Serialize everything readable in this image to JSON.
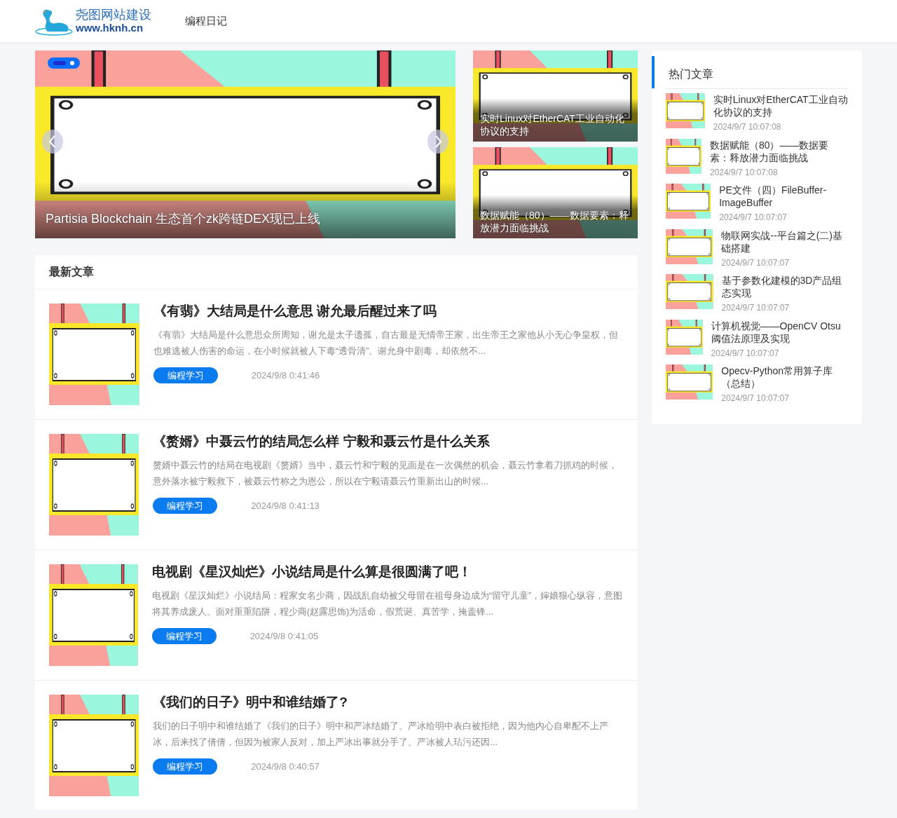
{
  "header": {
    "logo_title": "尧图网站建设",
    "logo_url": "www.hknh.cn",
    "nav": [
      {
        "label": "编程日记",
        "selected": false
      }
    ]
  },
  "carousel": {
    "caption": "Partisia Blockchain 生态首个zk跨链DEX现已上线",
    "indicators": [
      {
        "selected": true
      },
      {
        "selected": false
      }
    ]
  },
  "featured": [
    {
      "caption": "实时Linux对EtherCAT工业自动化协议的支持"
    },
    {
      "caption": "数据赋能（80）——数据要素：释放潜力面临挑战"
    }
  ],
  "latest": {
    "title": "最新文章",
    "articles": [
      {
        "title": "《有翡》大结局是什么意思 谢允最后醒过来了吗",
        "excerpt": "《有翡》大结局是什么意思众所周知，谢允是太子遗孤，自古最是无情帝王家，出生帝王之家他从小无心争皇权，但也难逃被人伤害的命运，在小时候就被人下毒“透骨清”。谢允身中剧毒，却依然不...",
        "tag": "编程学习",
        "time": "2024/9/8 0:41:46"
      },
      {
        "title": "《赘婿》中聂云竹的结局怎么样 宁毅和聂云竹是什么关系",
        "excerpt": "赘婿中聂云竹的结局在电视剧《赘婿》当中，聂云竹和宁毅的见面是在一次偶然的机会，聂云竹拿着刀抓鸡的时候，意外落水被宁毅救下，被聂云竹称之为恩公，所以在宁毅请聂云竹重新出山的时候...",
        "tag": "编程学习",
        "time": "2024/9/8 0:41:13"
      },
      {
        "title": "电视剧《星汉灿烂》小说结局是什么算是很圆满了吧！",
        "excerpt": "电视剧《星汉灿烂》小说结局：程家女名少商，因战乱自幼被父母留在祖母身边成为“留守儿童”，婶娘狠心纵容，意图将其养成废人。面对重重陷阱，程少商(赵露思饰)为活命，假荒诞、真苦学，掩盖锋...",
        "tag": "编程学习",
        "time": "2024/9/8 0:41:05"
      },
      {
        "title": "《我们的日子》明中和谁结婚了?",
        "excerpt": "我们的日子明中和谁结婚了《我们的日子》明中和严冰结婚了。严冰给明中表白被拒绝，因为他内心自卑配不上严冰，后来找了倩倩，但因为被家人反对，加上严冰出事就分手了。严冰被人玷污还因...",
        "tag": "编程学习",
        "time": "2024/9/8 0:40:57"
      }
    ]
  },
  "hot": {
    "title": "热门文章",
    "articles": [
      {
        "title": "实时Linux对EtherCAT工业自动化协议的支持",
        "time": "2024/9/7 10:07:08"
      },
      {
        "title": "数据赋能（80）——数据要素：释放潜力面临挑战",
        "time": "2024/9/7 10:07:08"
      },
      {
        "title": "PE文件（四）FileBuffer-ImageBuffer",
        "time": "2024/9/7 10:07:07"
      },
      {
        "title": "物联网实战--平台篇之(二)基础搭建",
        "time": "2024/9/7 10:07:07"
      },
      {
        "title": "基于参数化建模的3D产品组态实现",
        "time": "2024/9/7 10:07:07"
      },
      {
        "title": "计算机视觉——OpenCV Otsu阈值法原理及实现",
        "time": "2024/9/7 10:07:07"
      },
      {
        "title": "Opecv-Python常用算子库（总结）",
        "time": "2024/9/7 10:07:07"
      }
    ]
  }
}
